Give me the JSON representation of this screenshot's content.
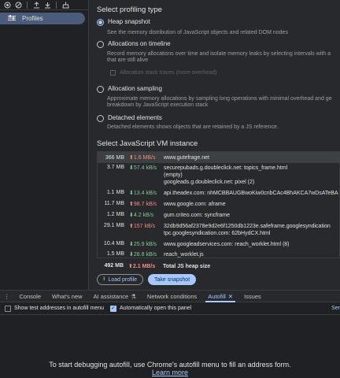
{
  "sidebar": {
    "toolbar_icons": [
      "record-icon",
      "clear-icon",
      "upload-icon",
      "download-icon",
      "sweep-icon"
    ],
    "profiles_label": "Profiles"
  },
  "profiling": {
    "title": "Select profiling type",
    "options": [
      {
        "title": "Heap snapshot",
        "desc": [
          "See the memory distribution of JavaScript objects and related DOM nodes"
        ],
        "checked": true
      },
      {
        "title": "Allocations on timeline",
        "desc": [
          "Record memory allocations over time and isolate memory leaks by selecting intervals with a",
          "that are still alive"
        ],
        "checked": false
      },
      {
        "title": "Allocation sampling",
        "desc": [
          "Approximate memory allocations by sampling long operations with minimal overhead and ge",
          "breakdown by JavaScript execution stack"
        ],
        "checked": false
      },
      {
        "title": "Detached elements",
        "desc": [
          "Detached elements shows objects that are retained by a JS reference."
        ],
        "checked": false
      }
    ],
    "stack_traces_label": "Allocation stack traces (more overhead)"
  },
  "vm": {
    "title": "Select JavaScript VM instance",
    "rows": [
      {
        "size": "366 MB",
        "rate": "1.6 MB/s",
        "dir": "up",
        "lines": [
          "www.gutefrage.net"
        ]
      },
      {
        "size": "3.7 MB",
        "rate": "57.4 kB/s",
        "dir": "down",
        "lines": [
          "securepubads.g.doubleclick.net: topics_frame.html",
          "(empty)",
          "googleads.g.doubleclick.net: pixel (2)"
        ]
      },
      {
        "size": "1.1 MB",
        "rate": "13.4 kB/s",
        "dir": "down",
        "lines": [
          "api.theadex.com: nhMCBBAUGBwoKiw0cnbCAc4BhAKCA7wDsATeBA"
        ]
      },
      {
        "size": "11.7 MB",
        "rate": "98.7 kB/s",
        "dir": "up",
        "lines": [
          "www.google.com: aframe"
        ]
      },
      {
        "size": "1.2 MB",
        "rate": "4.2 kB/s",
        "dir": "down",
        "lines": [
          "gum.criteo.com: syncframe"
        ]
      },
      {
        "size": "29.1 MB",
        "rate": "157 kB/s",
        "dir": "up",
        "lines": [
          "32db9d56af2378e9d2e6f1250db1223e.safeframe.googlesyndication",
          "tpc.googlesyndication.com: 62bHydCX.html"
        ]
      },
      {
        "size": "10.4 MB",
        "rate": "25.9 kB/s",
        "dir": "down",
        "lines": [
          "www.googleadservices.com: reach_worklet.html (8)"
        ]
      },
      {
        "size": "1.5 MB",
        "rate": "28.8 kB/s",
        "dir": "down",
        "lines": [
          "reach_worklet.js"
        ]
      }
    ],
    "total": {
      "size": "492 MB",
      "rate": "2.1 MB/s",
      "label": "Total JS heap size"
    },
    "load_label": "Load profile",
    "snapshot_label": "Take snapshot"
  },
  "drawer": {
    "tabs": [
      "Console",
      "What's new",
      "AI assistance",
      "Network conditions",
      "Autofill",
      "Issues"
    ],
    "active_tab": "Autofill",
    "show_test_label": "Show test addresses in autofill menu",
    "auto_open_label": "Automatically open this panel",
    "right_cut_label": "Ser",
    "message": "To start debugging autofill, use Chrome's autofill menu to fill an address form.",
    "learn_more": "Learn more"
  },
  "colors": {
    "accent": "#a8c7fa",
    "rate_up": "#f28b82",
    "rate_down": "#81c995"
  }
}
